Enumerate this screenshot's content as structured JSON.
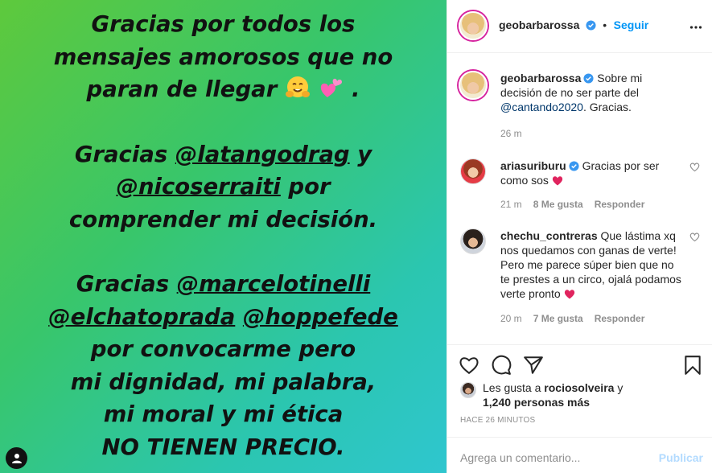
{
  "image": {
    "story_lines": {
      "p1": [
        "Gracias por todos los",
        "mensajes amorosos que no",
        "paran de llegar"
      ],
      "p2_prefix": "Gracias ",
      "p2_mention1": "@latangodrag",
      "p2_mid": " y",
      "p2_mention2": "@nicoserraiti",
      "p2_after": " por",
      "p2_line3": "comprender mi decisión.",
      "p3_prefix": "Gracias ",
      "p3_mention1": "@marcelotinelli",
      "p3_mention2": "@elchatoprada",
      "p3_mention3": "@hoppefede",
      "p3_lines": [
        "por convocarme pero",
        "mi dignidad, mi palabra,",
        "mi moral y mi ética",
        "NO TIENEN PRECIO."
      ]
    },
    "period": ".",
    "background_colors": [
      "#5ec93c",
      "#2fc6cf"
    ]
  },
  "header": {
    "username": "geobarbarossa",
    "separator": "•",
    "follow_label": "Seguir",
    "more_icon": "more-options-icon"
  },
  "caption": {
    "username": "geobarbarossa",
    "text_before": "Sobre mi decisión de no ser parte del ",
    "mention": "@cantando2020",
    "text_after": ". Gracias.",
    "time": "26 m"
  },
  "comments": [
    {
      "username": "ariasuriburu",
      "text": "Gracias por ser como sos",
      "time": "21 m",
      "likes": "8 Me gusta",
      "reply": "Responder"
    },
    {
      "username": "chechu_contreras",
      "text": "Que lástima xq nos quedamos con ganas de verte! Pero me parece súper bien que no te prestes a un circo, ojalá podamos verte pronto",
      "time": "20 m",
      "likes": "7 Me gusta",
      "reply": "Responder"
    }
  ],
  "likes": {
    "prefix": "Les gusta a ",
    "user": "rociosolveira",
    "suffix": " y",
    "count": "1,240 personas más"
  },
  "time_ago": "HACE 26 MINUTOS",
  "add_comment": {
    "placeholder": "Agrega un comentario...",
    "post_label": "Publicar"
  },
  "colors": {
    "accent": "#0095f6",
    "heart": "#ed4956",
    "muted": "#8e8e8e"
  }
}
